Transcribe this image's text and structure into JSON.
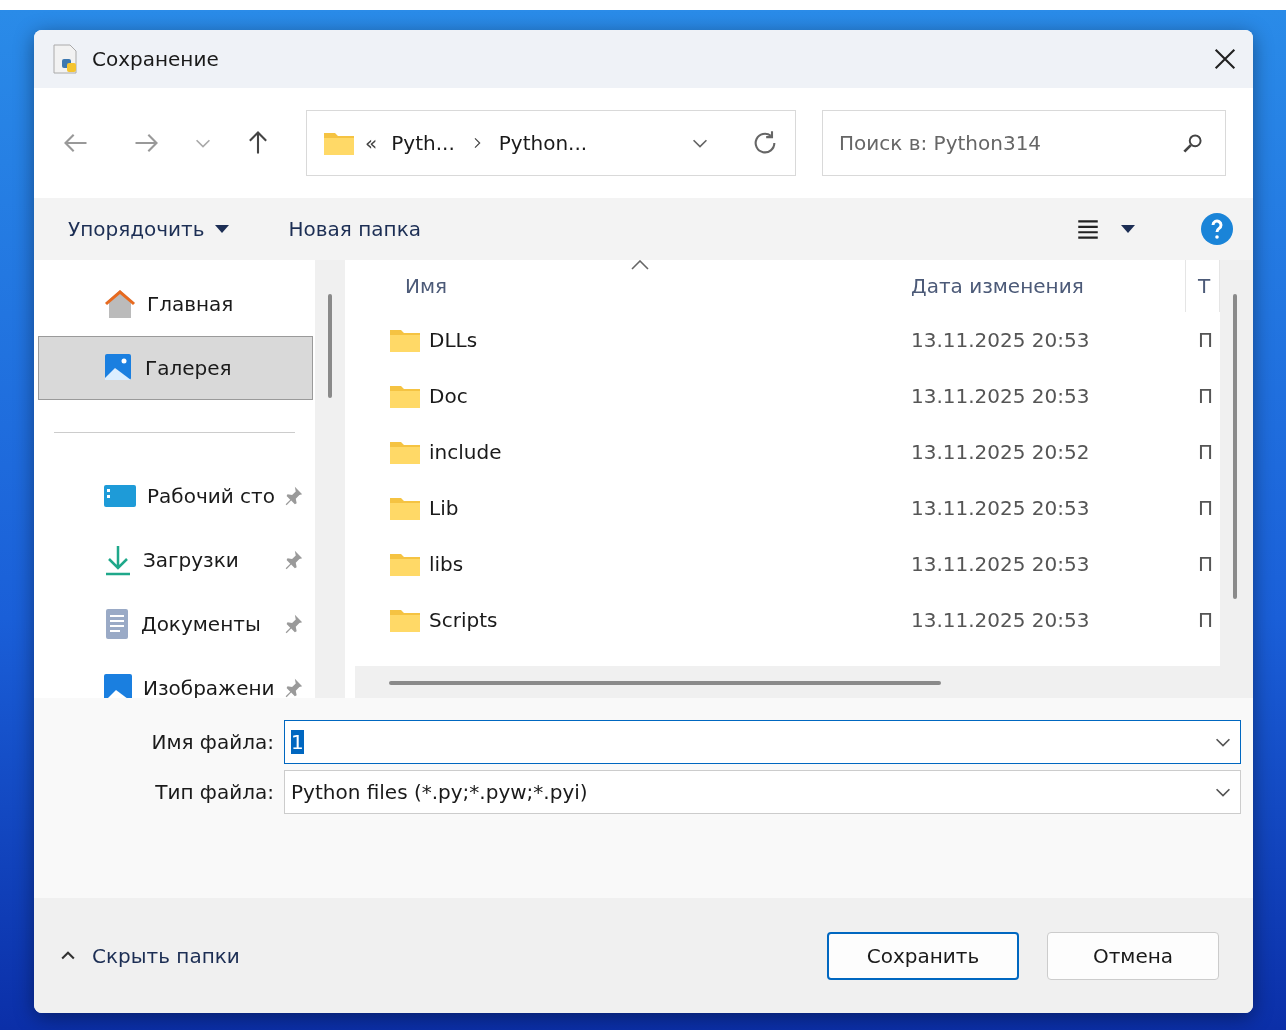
{
  "window": {
    "title": "Сохранение"
  },
  "address_bar": {
    "overflow": "«",
    "crumbs": [
      "Pyth...",
      "Python..."
    ]
  },
  "search": {
    "placeholder": "Поиск в: Python314"
  },
  "command_bar": {
    "organize": "Упорядочить",
    "new_folder": "Новая папка"
  },
  "sidebar": {
    "items": [
      {
        "kind": "home",
        "label": "Главная",
        "selected": false,
        "pinned": false
      },
      {
        "kind": "gallery",
        "label": "Галерея",
        "selected": true,
        "pinned": false
      },
      {
        "kind": "divider"
      },
      {
        "kind": "desktop",
        "label": "Рабочий сто",
        "selected": false,
        "pinned": true
      },
      {
        "kind": "downloads",
        "label": "Загрузки",
        "selected": false,
        "pinned": true
      },
      {
        "kind": "documents",
        "label": "Документы",
        "selected": false,
        "pinned": true
      },
      {
        "kind": "pictures",
        "label": "Изображени",
        "selected": false,
        "pinned": true
      }
    ]
  },
  "table": {
    "columns": [
      {
        "label": "Имя",
        "sorted": true
      },
      {
        "label": "Дата изменения",
        "sorted": false
      },
      {
        "label": "Т",
        "sorted": false
      }
    ],
    "rows": [
      {
        "name": "DLLs",
        "date": "13.11.2025 20:53",
        "type": "П"
      },
      {
        "name": "Doc",
        "date": "13.11.2025 20:53",
        "type": "П"
      },
      {
        "name": "include",
        "date": "13.11.2025 20:52",
        "type": "П"
      },
      {
        "name": "Lib",
        "date": "13.11.2025 20:53",
        "type": "П"
      },
      {
        "name": "libs",
        "date": "13.11.2025 20:53",
        "type": "П"
      },
      {
        "name": "Scripts",
        "date": "13.11.2025 20:53",
        "type": "П"
      }
    ]
  },
  "form": [
    {
      "label": "Имя файла:",
      "value": "1",
      "focused": true,
      "value_selected": true
    },
    {
      "label": "Тип файла:",
      "value": "Python files (*.py;*.pyw;*.pyi)",
      "focused": false,
      "value_selected": false
    }
  ],
  "footer": {
    "toggle": "Скрыть папки",
    "buttons": [
      {
        "label": "Сохранить",
        "default": true
      },
      {
        "label": "Отмена",
        "default": false
      }
    ]
  }
}
